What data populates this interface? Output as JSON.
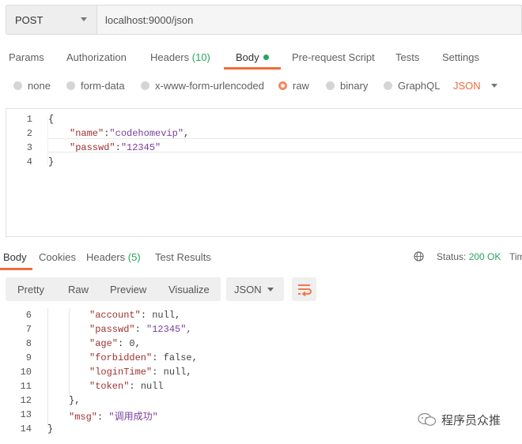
{
  "request": {
    "method": "POST",
    "url": "localhost:9000/json"
  },
  "request_tabs": {
    "params": "Params",
    "authorization": "Authorization",
    "headers": "Headers",
    "headers_count": "(10)",
    "body": "Body",
    "prerequest": "Pre-request Script",
    "tests": "Tests",
    "settings": "Settings"
  },
  "body_types": {
    "none": "none",
    "form_data": "form-data",
    "urlencoded": "x-www-form-urlencoded",
    "raw": "raw",
    "binary": "binary",
    "graphql": "GraphQL",
    "format": "JSON"
  },
  "request_body": {
    "lines": [
      {
        "n": "1",
        "text": "{"
      },
      {
        "n": "2",
        "key": "\"name\"",
        "sep": ":",
        "val": "\"codehomevip\"",
        "tail": ","
      },
      {
        "n": "3",
        "key": "\"passwd\"",
        "sep": ":",
        "val": "\"12345\"",
        "tail": ""
      },
      {
        "n": "4",
        "text": "}"
      }
    ]
  },
  "response_tabs": {
    "body": "Body",
    "cookies": "Cookies",
    "headers": "Headers",
    "headers_count": "(5)",
    "test_results": "Test Results",
    "status_label": "Status:",
    "status_value": "200 OK",
    "time_label": "Tim"
  },
  "view_modes": {
    "pretty": "Pretty",
    "raw": "Raw",
    "preview": "Preview",
    "visualize": "Visualize",
    "format": "JSON"
  },
  "response_body": {
    "line6_n": "6",
    "line6_key": "\"account\"",
    "line6_val": "null,",
    "line7_n": "7",
    "line7_key": "\"passwd\"",
    "line7_val": "\"12345\",",
    "line8_n": "8",
    "line8_key": "\"age\"",
    "line8_val": "0,",
    "line9_n": "9",
    "line9_key": "\"forbidden\"",
    "line9_val": "false,",
    "line10_n": "10",
    "line10_key": "\"loginTime\"",
    "line10_val": "null,",
    "line11_n": "11",
    "line11_key": "\"token\"",
    "line11_val": "null",
    "line12_n": "12",
    "line12_text": "},",
    "line13_n": "13",
    "line13_key": "\"msg\"",
    "line13_val": "\"调用成功\"",
    "line14_n": "14",
    "line14_text": "}"
  },
  "watermark": "程序员众推",
  "colors": {
    "accent": "#f26b3a",
    "success": "#26a65b"
  },
  "icons": [
    "chevron-down-icon",
    "globe-icon",
    "wrap-lines-icon",
    "wechat-icon"
  ]
}
